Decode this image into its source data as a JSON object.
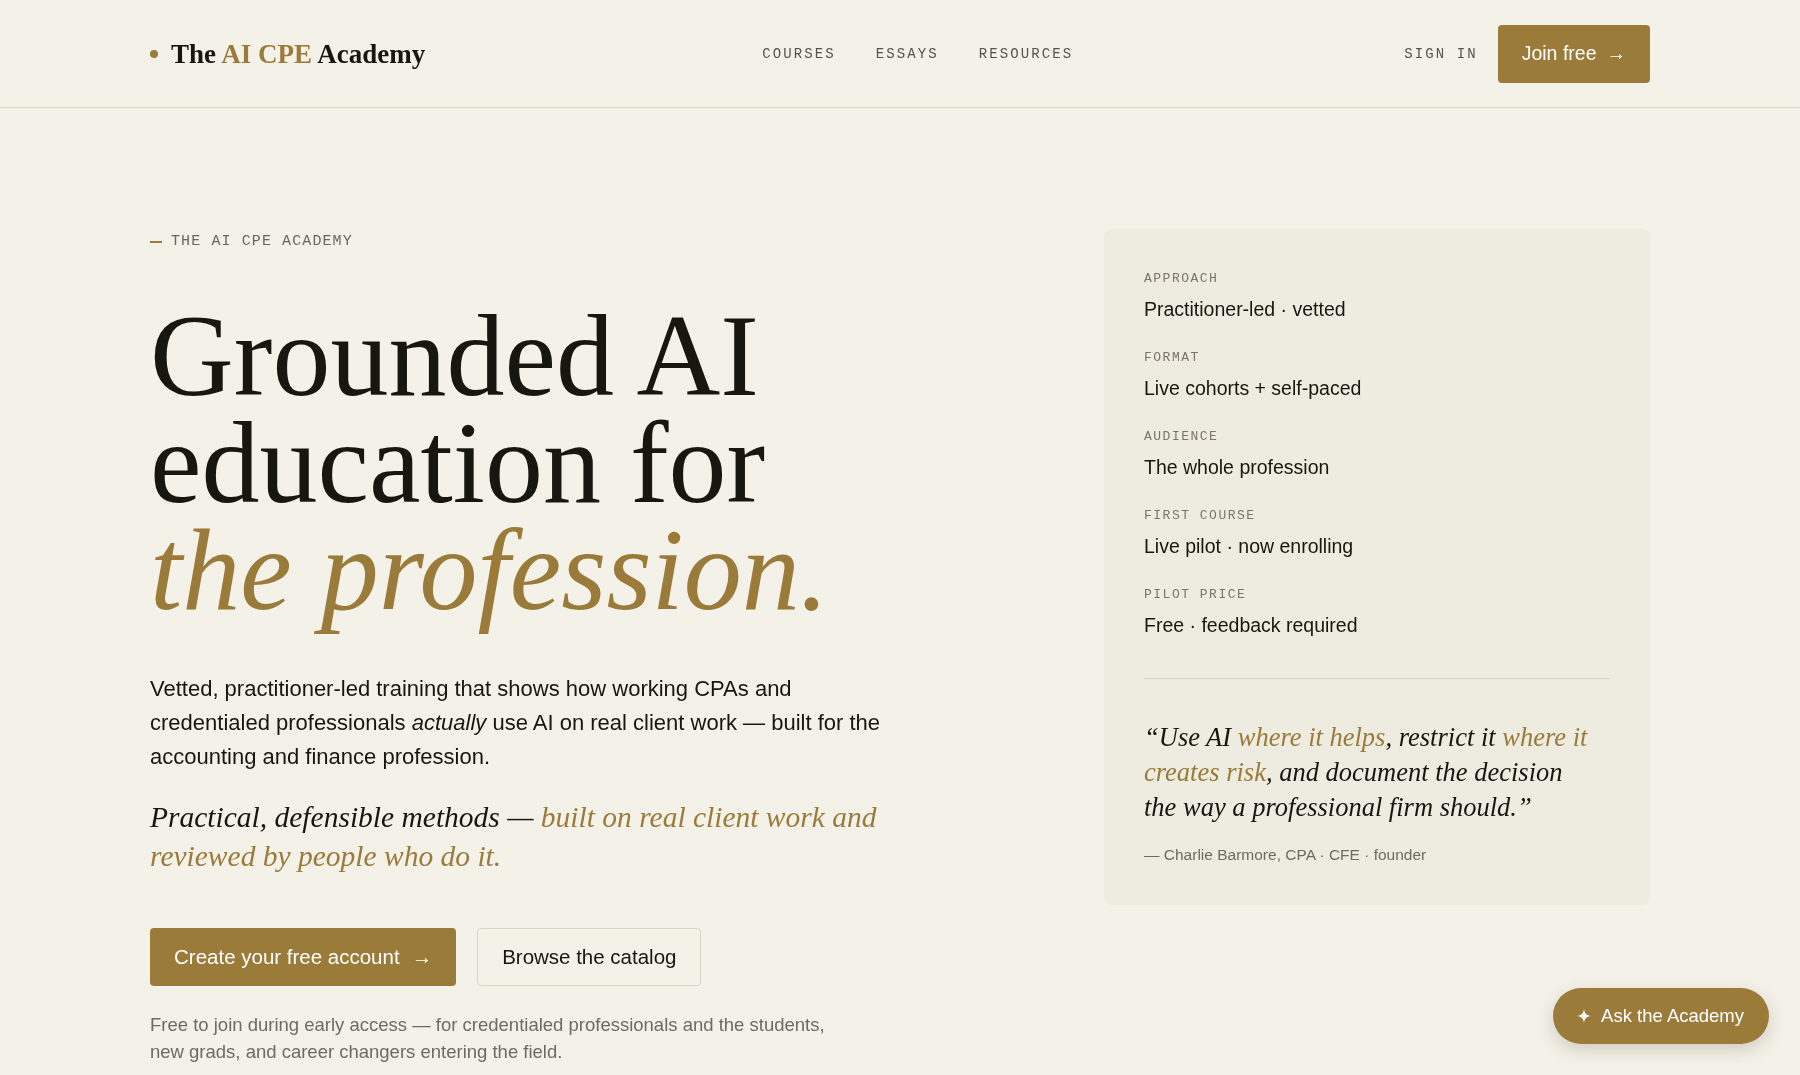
{
  "header": {
    "logo": [
      {
        "text": "The ",
        "accent": false
      },
      {
        "text": "AI CPE",
        "accent": true
      },
      {
        "text": " Academy",
        "accent": false
      }
    ],
    "nav": [
      "COURSES",
      "ESSAYS",
      "RESOURCES"
    ],
    "sign_in": "SIGN IN",
    "cta": {
      "label": "Join free",
      "arrow": "→"
    }
  },
  "hero": {
    "eyebrow": "THE AI CPE ACADEMY",
    "headline": [
      {
        "text": "Grounded AI education for",
        "accent": false
      },
      {
        "text": "the profession.",
        "accent": true
      }
    ],
    "intro": "Vetted, practitioner-led training that shows how working CPAs and credentialed professionals *actually* use AI on real client work — built for the accounting and finance profession.",
    "lead": [
      {
        "text": "Practical, defensible methods — ",
        "accent": false
      },
      {
        "text": "built on real client work and reviewed by people who do it.",
        "accent": true
      }
    ],
    "buttons": [
      {
        "label": "Create your free account",
        "arrow": "→",
        "kind": "primary"
      },
      {
        "label": "Browse the catalog",
        "kind": "secondary"
      }
    ],
    "note": "Free to join during early access — for credentialed professionals and the students, new grads, and career changers entering the field."
  },
  "facts_card": {
    "facts": [
      {
        "label": "APPROACH",
        "value": "Practitioner-led · vetted"
      },
      {
        "label": "FORMAT",
        "value": "Live cohorts + self-paced"
      },
      {
        "label": "AUDIENCE",
        "value": "The whole profession"
      },
      {
        "label": "FIRST COURSE",
        "value": "Live pilot · now enrolling"
      },
      {
        "label": "PILOT PRICE",
        "value": "Free · feedback required"
      }
    ],
    "quote": [
      {
        "text": "“Use AI ",
        "accent": false
      },
      {
        "text": "where it helps",
        "accent": true
      },
      {
        "text": ", restrict it ",
        "accent": false
      },
      {
        "text": "where it creates risk",
        "accent": true
      },
      {
        "text": ", and document the decision the way a professional firm should.”",
        "accent": false
      }
    ],
    "attribution": "— Charlie Barmore, CPA · CFE · founder"
  },
  "assistant_button": {
    "label": "Ask the Academy"
  }
}
